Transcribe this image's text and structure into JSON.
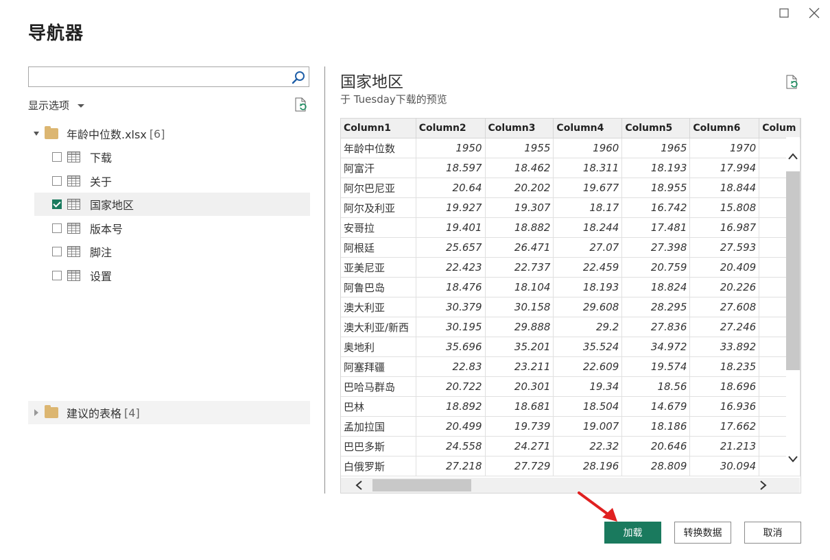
{
  "dialog": {
    "title": "导航器"
  },
  "search": {
    "value": "",
    "placeholder": ""
  },
  "display_options": {
    "label": "显示选项"
  },
  "tree": {
    "file": {
      "name": "年龄中位数.xlsx",
      "count": "[6]"
    },
    "items": [
      {
        "label": "下载",
        "checked": false
      },
      {
        "label": "关于",
        "checked": false
      },
      {
        "label": "国家地区",
        "checked": true
      },
      {
        "label": "版本号",
        "checked": false
      },
      {
        "label": "脚注",
        "checked": false
      },
      {
        "label": "设置",
        "checked": false
      }
    ],
    "suggested": {
      "name": "建议的表格",
      "count": "[4]"
    }
  },
  "preview": {
    "title": "国家地区",
    "subtitle": "于 Tuesday下载的预览",
    "columns": [
      "Column1",
      "Column2",
      "Column3",
      "Column4",
      "Column5",
      "Column6",
      "Colum"
    ],
    "rows": [
      [
        "年龄中位数",
        "1950",
        "1955",
        "1960",
        "1965",
        "1970"
      ],
      [
        "阿富汗",
        "18.597",
        "18.462",
        "18.311",
        "18.193",
        "17.994"
      ],
      [
        "阿尔巴尼亚",
        "20.64",
        "20.202",
        "19.677",
        "18.955",
        "18.844"
      ],
      [
        "阿尔及利亚",
        "19.927",
        "19.307",
        "18.17",
        "16.742",
        "15.808"
      ],
      [
        "安哥拉",
        "19.401",
        "18.882",
        "18.244",
        "17.481",
        "16.987"
      ],
      [
        "阿根廷",
        "25.657",
        "26.471",
        "27.07",
        "27.398",
        "27.593"
      ],
      [
        "亚美尼亚",
        "22.423",
        "22.737",
        "22.459",
        "20.759",
        "20.409"
      ],
      [
        "阿鲁巴岛",
        "18.476",
        "18.104",
        "18.193",
        "18.824",
        "20.226"
      ],
      [
        "澳大利亚",
        "30.379",
        "30.158",
        "29.608",
        "28.295",
        "27.608"
      ],
      [
        "澳大利亚/新西",
        "30.195",
        "29.888",
        "29.2",
        "27.836",
        "27.246"
      ],
      [
        "奥地利",
        "35.696",
        "35.201",
        "35.524",
        "34.972",
        "33.892"
      ],
      [
        "阿塞拜疆",
        "22.83",
        "23.211",
        "22.609",
        "19.574",
        "18.235"
      ],
      [
        "巴哈马群岛",
        "20.722",
        "20.301",
        "19.34",
        "18.56",
        "18.696"
      ],
      [
        "巴林",
        "18.892",
        "18.681",
        "18.504",
        "14.679",
        "16.936"
      ],
      [
        "孟加拉国",
        "20.499",
        "19.739",
        "19.007",
        "18.186",
        "17.662"
      ],
      [
        "巴巴多斯",
        "24.558",
        "24.271",
        "22.32",
        "20.646",
        "21.213"
      ],
      [
        "白俄罗斯",
        "27.218",
        "27.729",
        "28.196",
        "28.809",
        "30.094"
      ]
    ]
  },
  "buttons": {
    "load": "加载",
    "transform": "转换数据",
    "cancel": "取消"
  },
  "colors": {
    "accent": "#1a7a5e",
    "annotation_arrow": "#e02020"
  }
}
